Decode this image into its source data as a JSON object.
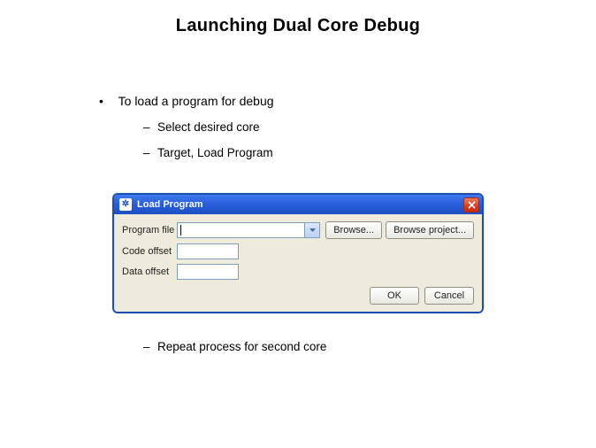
{
  "title": "Launching Dual Core Debug",
  "bullets": {
    "top": "To load a program for debug",
    "sub1": "Select desired core",
    "sub2": "Target, Load Program",
    "sub3": "Repeat process for second core"
  },
  "dialog": {
    "window_title": "Load Program",
    "program_file_label": "Program file",
    "program_file_value": "",
    "code_offset_label": "Code offset",
    "code_offset_value": "",
    "data_offset_label": "Data offset",
    "data_offset_value": "",
    "browse_button": "Browse...",
    "browse_project_button": "Browse project...",
    "ok_button": "OK",
    "cancel_button": "Cancel"
  }
}
